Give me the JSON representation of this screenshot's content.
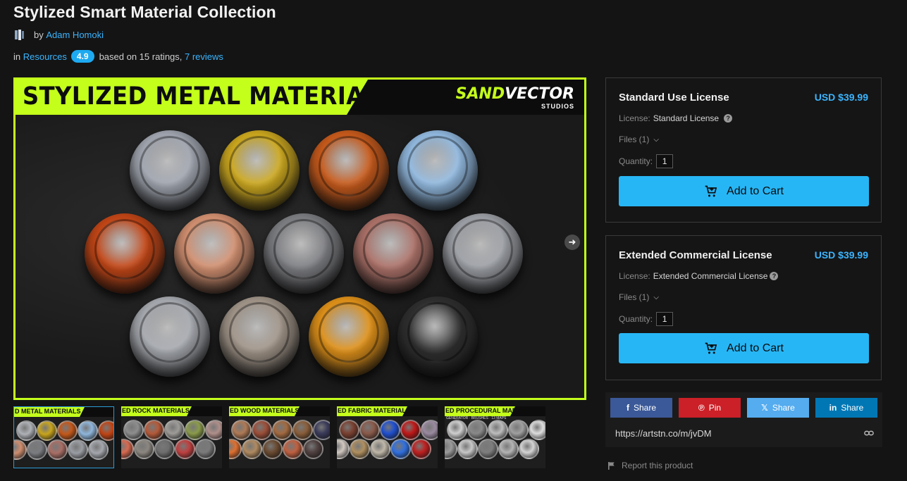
{
  "page": {
    "title": "Stylized Smart Material Collection",
    "by_label": "by",
    "author": "Adam Homoki",
    "in_label": "in",
    "category": "Resources",
    "rating": "4.9",
    "ratings_text": "based on 15 ratings,",
    "reviews_link": "7 reviews"
  },
  "hero": {
    "banner_title": "STYLIZED METAL MATERIALS",
    "brand_part1": "SAND",
    "brand_part2": "VECTOR",
    "brand_sub": "STUDIOS",
    "next_arrow": "➜",
    "spheres": [
      {
        "color": "#9ea3ad"
      },
      {
        "color": "#c9a51d"
      },
      {
        "color": "#c4581a"
      },
      {
        "color": "#8fb6dc"
      },
      {
        "color": "#c04415"
      },
      {
        "color": "#cf8d6e"
      },
      {
        "color": "#7b7c80"
      },
      {
        "color": "#a96f66"
      },
      {
        "color": "#9a9da3"
      },
      {
        "color": "#a4a7ad"
      },
      {
        "color": "#9e9286"
      },
      {
        "color": "#dc8e17"
      },
      {
        "color": "#2e2d2e"
      }
    ]
  },
  "thumbnails": [
    {
      "label": "D METAL MATERIALS",
      "sub": "",
      "colors": [
        "#aeb1b6",
        "#c9a51d",
        "#c4581a",
        "#8fb6dc",
        "#c04415",
        "#cf8d6e",
        "#7b7c80",
        "#a96f66",
        "#9a9da3",
        "#a4a7ad"
      ]
    },
    {
      "label": "ED ROCK MATERIALS",
      "sub": "",
      "colors": [
        "#8e8e8e",
        "#b55a3a",
        "#9e9c98",
        "#8a9b4a",
        "#b08f8a",
        "#d86a50",
        "#8c8780",
        "#6e6e6e",
        "#c04040",
        "#7a7a7a"
      ]
    },
    {
      "label": "ED WOOD MATERIALS",
      "sub": "",
      "colors": [
        "#b07a55",
        "#9c4e38",
        "#a36a40",
        "#8a5e3a",
        "#3a3a5a",
        "#e07030",
        "#b08a60",
        "#6a4a30",
        "#c06040",
        "#504040"
      ]
    },
    {
      "label": "ED FABRIC MATERIALS",
      "sub": "",
      "colors": [
        "#7a4030",
        "#8a5a4a",
        "#2050d0",
        "#c01818",
        "#9a8aa0",
        "#d0c8c0",
        "#b09060",
        "#c0b8a8",
        "#3070e0",
        "#c02020"
      ]
    },
    {
      "label": "ED PROCEDURAL MAPS",
      "sub": "GENERATOR · BRUSHES · 13 MAPS",
      "colors": [
        "#cfcfcf",
        "#8a8a8a",
        "#bdbdbd",
        "#a0a0a0",
        "#dedede",
        "#9c9c9c",
        "#c8c8c8",
        "#7e7e7e",
        "#b4b4b4",
        "#d4d4d4"
      ]
    }
  ],
  "licenses": [
    {
      "name": "Standard Use License",
      "price": "USD $39.99",
      "license_label": "License:",
      "license_value": "Standard License",
      "help": "?",
      "files_label": "Files (1)",
      "quantity_label": "Quantity:",
      "quantity": "1",
      "cart_label": "Add to Cart"
    },
    {
      "name": "Extended Commercial License",
      "price": "USD $39.99",
      "license_label": "License:",
      "license_value": "Extended Commercial License",
      "help": "?",
      "files_label": "Files (1)",
      "quantity_label": "Quantity:",
      "quantity": "1",
      "cart_label": "Add to Cart"
    }
  ],
  "share": {
    "facebook": {
      "icon": "f",
      "label": "Share",
      "color": "#3b5998"
    },
    "pinterest": {
      "icon": "℗",
      "label": "Pin",
      "color": "#cb2027"
    },
    "x": {
      "icon": "𝕏",
      "label": "Share",
      "color": "#55acee"
    },
    "linkedin": {
      "icon": "in",
      "label": "Share",
      "color": "#0077b5"
    },
    "url": "https://artstn.co/m/jvDM"
  },
  "report": "Report this product",
  "colors": {
    "accent": "#3ab5ff",
    "cart_button": "#27b6f5",
    "banner_green": "#c4ff1b"
  }
}
